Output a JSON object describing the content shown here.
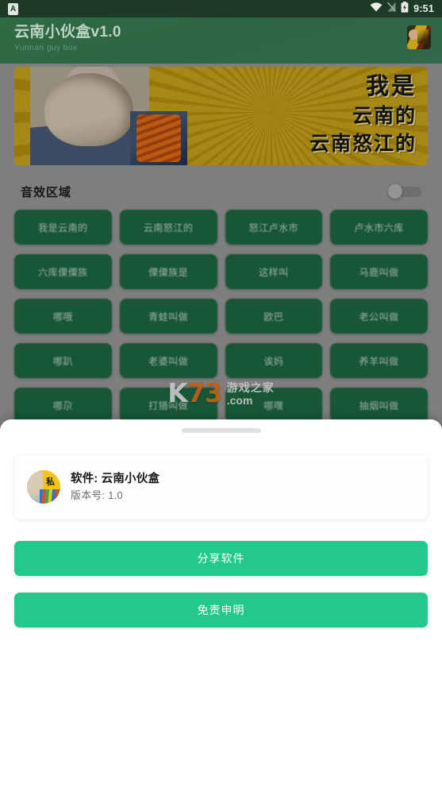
{
  "status_bar": {
    "notification_badge": "A",
    "time": "9:51",
    "icons": [
      "wifi-icon",
      "sim-signal-icon",
      "battery-charging-icon"
    ]
  },
  "header": {
    "title": "云南小伙盒v1.0",
    "subtitle": "Yunnan guy box",
    "avatar_icon": "app-logo-avatar"
  },
  "banner": {
    "line1": "我是",
    "line2": "云南的",
    "line3": "云南怒江的"
  },
  "section": {
    "title": "音效区域",
    "toggle_state": "off"
  },
  "sound_buttons": [
    "我是云南的",
    "云南怒江的",
    "怒江卢水市",
    "卢水市六库",
    "六库傈僳族",
    "傈僳族是",
    "这样叫",
    "马鹿叫做",
    "哪哦",
    "青蛙叫做",
    "欧巴",
    "老公叫做",
    "哪趴",
    "老婆叫做",
    "诶妈",
    "养羊叫做",
    "哪尕",
    "打猎叫做",
    "哪嘿",
    "抽烟叫做"
  ],
  "watermark": {
    "k": "K",
    "seventy_three": "73",
    "chinese": "游戏之家",
    "domain": ".com",
    "accent_color": "#e8761b"
  },
  "sheet": {
    "handle": "drag-handle",
    "software_label": "软件: 云南小伙盒",
    "version_label": "版本号: 1.0",
    "share_button": "分享软件",
    "disclaimer_button": "免责申明",
    "button_color": "#22c98a"
  },
  "theme": {
    "status_bar_bg": "#1d3a26",
    "header_bg": "#2f6b44",
    "body_bg": "#9a9a9a",
    "sound_button_bg": "#1d6b44",
    "banner_bg": "#c9a51c"
  }
}
